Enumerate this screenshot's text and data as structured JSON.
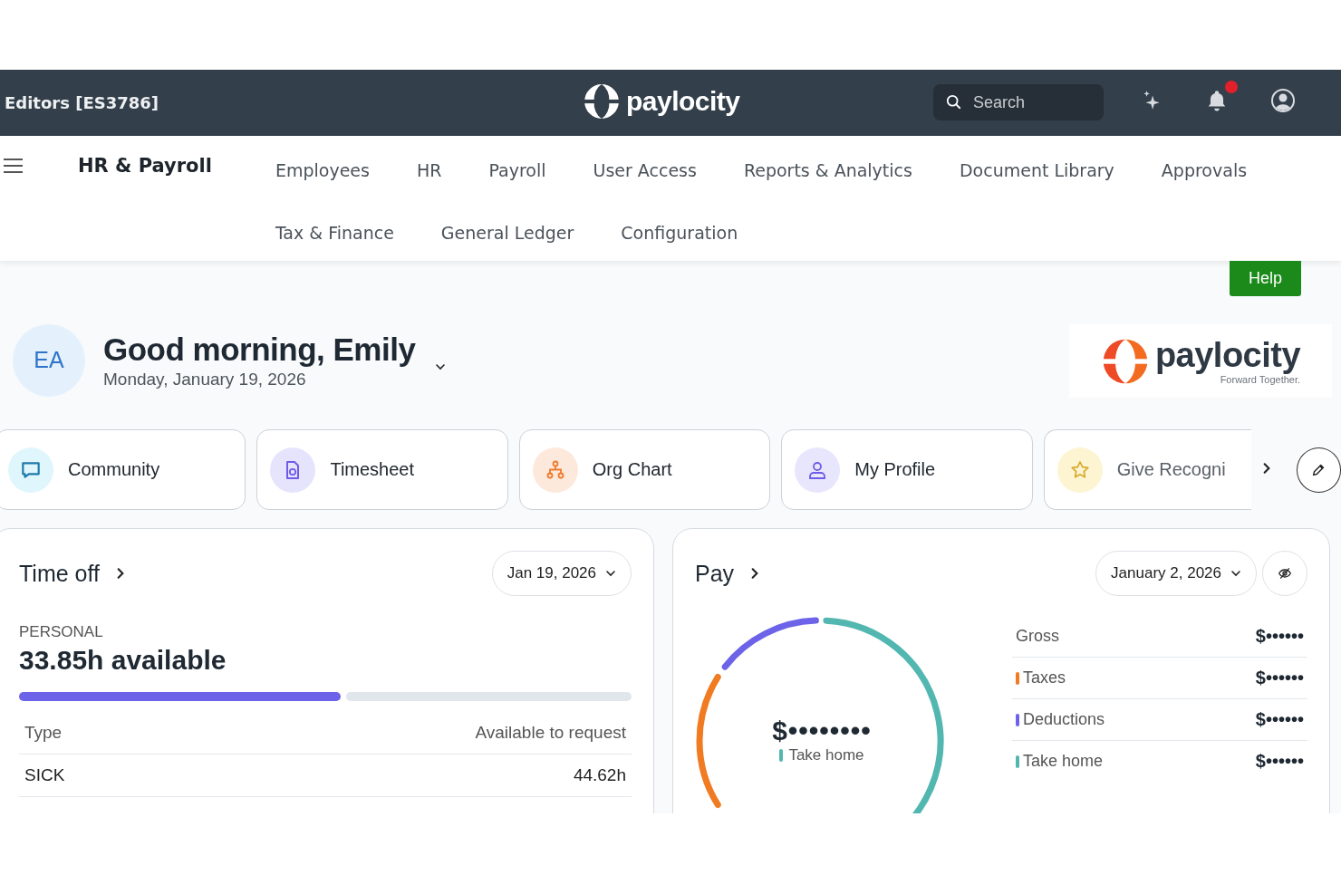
{
  "topbar": {
    "account": "Editors [ES3786]",
    "logo": "paylocity",
    "search": {
      "placeholder": "Search"
    },
    "notification_dot": true
  },
  "nav": {
    "title": "HR & Payroll",
    "items": [
      {
        "label": "Employees"
      },
      {
        "label": "HR"
      },
      {
        "label": "Payroll"
      },
      {
        "label": "User Access"
      },
      {
        "label": "Reports & Analytics"
      },
      {
        "label": "Document Library"
      },
      {
        "label": "Approvals"
      },
      {
        "label": "Tax & Finance"
      },
      {
        "label": "General Ledger"
      },
      {
        "label": "Configuration"
      }
    ]
  },
  "help": "Help",
  "greeting": {
    "initials": "EA",
    "title": "Good morning, Emily",
    "date": "Monday, January 19, 2026"
  },
  "brand": {
    "name": "paylocity",
    "tagline": "Forward Together."
  },
  "shortcuts": [
    {
      "label": "Community",
      "kind": "chat"
    },
    {
      "label": "Timesheet",
      "kind": "timesheet"
    },
    {
      "label": "Org Chart",
      "kind": "org"
    },
    {
      "label": "My Profile",
      "kind": "profile"
    },
    {
      "label": "Give Recogni",
      "kind": "star"
    }
  ],
  "time_off": {
    "title": "Time off",
    "date": "Jan 19, 2026",
    "category": "PERSONAL",
    "available": "33.85h available",
    "level": 0.525,
    "columns": [
      "Type",
      "Available to request"
    ],
    "rows": [
      {
        "type": "SICK",
        "value": "44.62h"
      }
    ]
  },
  "pay": {
    "title": "Pay",
    "date": "January 2, 2026",
    "total": "$••••••••",
    "total_label": "Take home",
    "rows": [
      {
        "label": "Gross",
        "value": "$••••••"
      },
      {
        "label": "Taxes",
        "value": "$••••••",
        "color": "#f07b22"
      },
      {
        "label": "Deductions",
        "value": "$••••••",
        "color": "#6c63e8"
      },
      {
        "label": "Take home",
        "value": "$••••••",
        "color": "#52b7b0"
      }
    ]
  }
}
